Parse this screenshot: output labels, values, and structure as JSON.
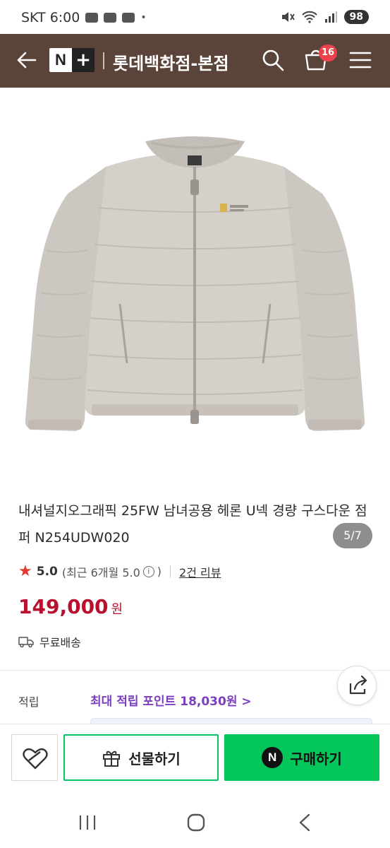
{
  "status_bar": {
    "carrier_time": "SKT 6:00",
    "dot": "•",
    "battery": "98"
  },
  "header": {
    "logo_n": "N",
    "logo_plus": "+",
    "store_name": "롯데백화점-본점",
    "cart_count": "16"
  },
  "product": {
    "image_counter": "5/7",
    "title": "내셔널지오그래픽 25FW 남녀공용 헤론 U넥 경량 구스다운 점퍼 N254UDW020",
    "rating": "5.0",
    "rating_sub": "(최근 6개월 5.0",
    "rating_sub_close": ")",
    "info_icon": "i",
    "review_link": "2건 리뷰",
    "price": "149,000",
    "currency": "원",
    "shipping": "무료배송",
    "earn_label": "적립",
    "earn_value": "최대 적립 포인트 18,030원 >"
  },
  "buy_bar": {
    "gift_label": "선물하기",
    "npay_letter": "N",
    "buy_label": "구매하기"
  },
  "colors": {
    "header_bg": "#5a4338",
    "price": "#b8102e",
    "naver_green": "#03c75a",
    "earn_purple": "#7a3fbf",
    "badge_red": "#e8424b"
  }
}
